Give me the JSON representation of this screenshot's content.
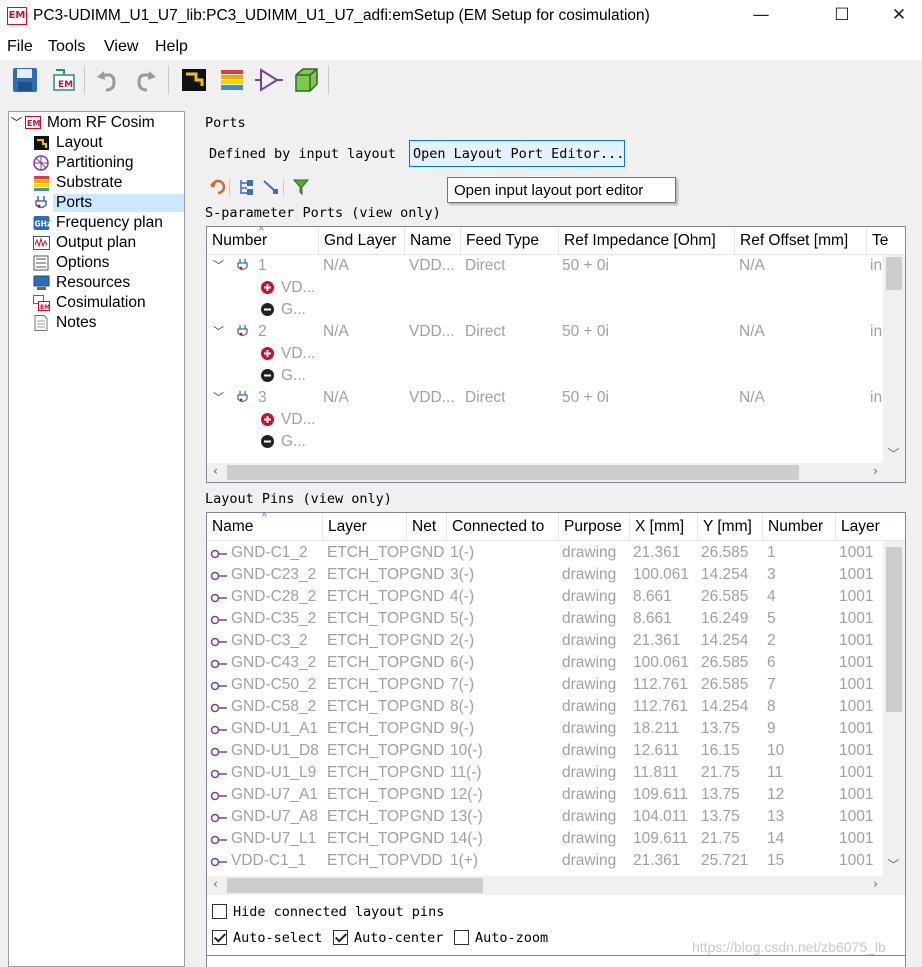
{
  "window": {
    "icon_label": "EM",
    "title": "PC3-UDIMM_U1_U7_lib:PC3_UDIMM_U1_U7_adfi:emSetup (EM Setup for cosimulation)",
    "minimize": "—",
    "maximize": "☐",
    "close": "✕"
  },
  "menu": [
    "File",
    "Tools",
    "View",
    "Help"
  ],
  "toolbar": {
    "icons": [
      "save-icon",
      "em-export-icon",
      "undo-icon",
      "redo-icon",
      "layout-icon",
      "substrate-icon",
      "port-icon",
      "3d-box-icon"
    ]
  },
  "tree": {
    "root": "Mom RF Cosim",
    "items": [
      {
        "label": "Layout",
        "icon": "layout-icon"
      },
      {
        "label": "Partitioning",
        "icon": "partitioning-icon"
      },
      {
        "label": "Substrate",
        "icon": "substrate-icon"
      },
      {
        "label": "Ports",
        "icon": "ports-icon"
      },
      {
        "label": "Frequency plan",
        "icon": "ghz-icon"
      },
      {
        "label": "Output plan",
        "icon": "output-icon"
      },
      {
        "label": "Options",
        "icon": "options-icon"
      },
      {
        "label": "Resources",
        "icon": "resources-icon"
      },
      {
        "label": "Cosimulation",
        "icon": "cosim-icon"
      },
      {
        "label": "Notes",
        "icon": "notes-icon"
      }
    ],
    "selected": "Ports"
  },
  "ports": {
    "group_label": "Ports",
    "defined_by": "Defined by input layout",
    "open_editor_button": "Open Layout Port Editor...",
    "tooltip": "Open input layout port editor",
    "sparam_label": "S-parameter Ports (view only)",
    "sparam_columns": [
      "Number",
      "Gnd Layer",
      "Name",
      "Feed Type",
      "Ref Impedance [Ohm]",
      "Ref Offset [mm]",
      "Te"
    ],
    "sparam_rows": [
      {
        "number": "1",
        "gnd": "N/A",
        "name": "VDD...",
        "feed": "Direct",
        "imp": "50 + 0i",
        "offset": "N/A",
        "te": "in",
        "plus": "VD...",
        "minus": "G..."
      },
      {
        "number": "2",
        "gnd": "N/A",
        "name": "VDD...",
        "feed": "Direct",
        "imp": "50 + 0i",
        "offset": "N/A",
        "te": "in",
        "plus": "VD...",
        "minus": "G..."
      },
      {
        "number": "3",
        "gnd": "N/A",
        "name": "VDD...",
        "feed": "Direct",
        "imp": "50 + 0i",
        "offset": "N/A",
        "te": "in",
        "plus": "VD...",
        "minus": "G..."
      }
    ]
  },
  "pins": {
    "label": "Layout Pins (view only)",
    "columns": [
      "Name",
      "Layer",
      "Net",
      "Connected to",
      "Purpose",
      "X [mm]",
      "Y [mm]",
      "Number",
      "Layer"
    ],
    "rows": [
      [
        "GND-C1_2",
        "ETCH_TOP",
        "GND",
        "1(-)",
        "drawing",
        "21.361",
        "26.585",
        "1",
        "1001"
      ],
      [
        "GND-C23_2",
        "ETCH_TOP",
        "GND",
        "3(-)",
        "drawing",
        "100.061",
        "14.254",
        "3",
        "1001"
      ],
      [
        "GND-C28_2",
        "ETCH_TOP",
        "GND",
        "4(-)",
        "drawing",
        "8.661",
        "26.585",
        "4",
        "1001"
      ],
      [
        "GND-C35_2",
        "ETCH_TOP",
        "GND",
        "5(-)",
        "drawing",
        "8.661",
        "16.249",
        "5",
        "1001"
      ],
      [
        "GND-C3_2",
        "ETCH_TOP",
        "GND",
        "2(-)",
        "drawing",
        "21.361",
        "14.254",
        "2",
        "1001"
      ],
      [
        "GND-C43_2",
        "ETCH_TOP",
        "GND",
        "6(-)",
        "drawing",
        "100.061",
        "26.585",
        "6",
        "1001"
      ],
      [
        "GND-C50_2",
        "ETCH_TOP",
        "GND",
        "7(-)",
        "drawing",
        "112.761",
        "26.585",
        "7",
        "1001"
      ],
      [
        "GND-C58_2",
        "ETCH_TOP",
        "GND",
        "8(-)",
        "drawing",
        "112.761",
        "14.254",
        "8",
        "1001"
      ],
      [
        "GND-U1_A1",
        "ETCH_TOP",
        "GND",
        "9(-)",
        "drawing",
        "18.211",
        "13.75",
        "9",
        "1001"
      ],
      [
        "GND-U1_D8",
        "ETCH_TOP",
        "GND",
        "10(-)",
        "drawing",
        "12.611",
        "16.15",
        "10",
        "1001"
      ],
      [
        "GND-U1_L9",
        "ETCH_TOP",
        "GND",
        "11(-)",
        "drawing",
        "11.811",
        "21.75",
        "11",
        "1001"
      ],
      [
        "GND-U7_A1",
        "ETCH_TOP",
        "GND",
        "12(-)",
        "drawing",
        "109.611",
        "13.75",
        "12",
        "1001"
      ],
      [
        "GND-U7_A8",
        "ETCH_TOP",
        "GND",
        "13(-)",
        "drawing",
        "104.011",
        "13.75",
        "13",
        "1001"
      ],
      [
        "GND-U7_L1",
        "ETCH_TOP",
        "GND",
        "14(-)",
        "drawing",
        "109.611",
        "21.75",
        "14",
        "1001"
      ],
      [
        "VDD-C1_1",
        "ETCH_TOP",
        "VDD",
        "1(+)",
        "drawing",
        "21.361",
        "25.721",
        "15",
        "1001"
      ]
    ]
  },
  "options": {
    "hide_connected": {
      "label": "Hide connected layout pins",
      "checked": false
    },
    "auto_select": {
      "label": "Auto-select",
      "checked": true
    },
    "auto_center": {
      "label": "Auto-center",
      "checked": true
    },
    "auto_zoom": {
      "label": "Auto-zoom",
      "checked": false
    }
  },
  "watermark": "https://blog.csdn.net/zb6075_lb"
}
